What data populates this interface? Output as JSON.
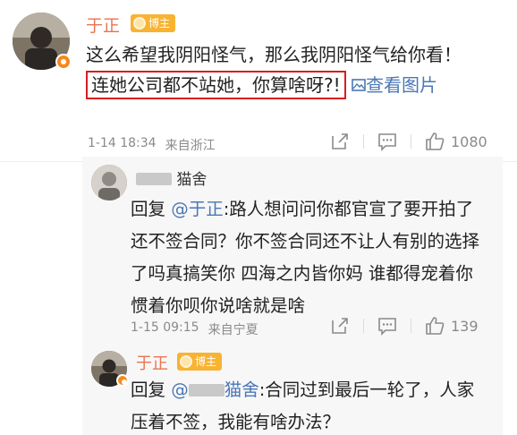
{
  "post": {
    "author": "于正",
    "badge": "博主",
    "text_before_highlight": "这么希望我阴阳怪气，那么我阴阳怪气给你看！",
    "highlight": "连她公司都不站她，你算啥呀?!",
    "pic_link_icon": "image-icon",
    "pic_link_label_a": "查看",
    "pic_link_label_b": "图片",
    "date": "1-14 18:34",
    "location": "来自浙江",
    "like_count": "1080"
  },
  "reply1": {
    "author_suffix": "猫舍",
    "reply_prefix": "回复",
    "mention": "@于正",
    "text": ":路人想问问你都官宣了要开拍了还不签合同？你不签合同还不让人有别的选择了吗真搞笑你 四海之内皆你妈 谁都得宠着你惯着你呗你说啥就是啥",
    "date": "1-15 09:15",
    "location": "来自宁夏",
    "like_count": "139"
  },
  "reply2": {
    "author": "于正",
    "badge": "博主",
    "reply_prefix": "回复",
    "mention_prefix": "@",
    "mention_suffix": "猫舍",
    "text": ":合同过到最后一轮了，人家压着不签，我能有啥办法？"
  },
  "icons": [
    "share-icon",
    "comment-icon",
    "like-icon",
    "coin-icon",
    "verified-icon"
  ],
  "colors": {
    "name": "#eb7350",
    "link": "#4b77b6",
    "highlight_border": "#d81e1e",
    "badge": "#f8b332"
  }
}
